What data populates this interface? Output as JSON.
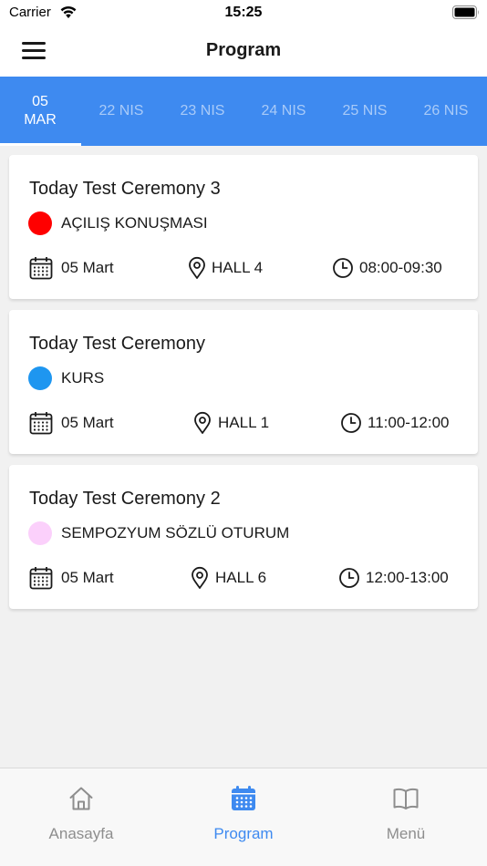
{
  "status_bar": {
    "carrier": "Carrier",
    "time": "15:25",
    "wifi_icon": "wifi-icon",
    "battery_icon": "battery-icon"
  },
  "nav": {
    "title": "Program",
    "menu_icon": "hamburger-menu-icon"
  },
  "date_tabs": [
    {
      "day": "05",
      "month": "MAR",
      "active": true
    },
    {
      "label": "22 NIS",
      "active": false
    },
    {
      "label": "23 NIS",
      "active": false
    },
    {
      "label": "24 NIS",
      "active": false
    },
    {
      "label": "25 NIS",
      "active": false
    },
    {
      "label": "26 NIS",
      "active": false
    }
  ],
  "sessions": [
    {
      "title": "Today Test Ceremony 3",
      "category": "AÇILIŞ KONUŞMASI",
      "category_color": "#ff0000",
      "date": "05 Mart",
      "hall": "HALL 4",
      "time": "08:00-09:30"
    },
    {
      "title": "Today Test Ceremony",
      "category": "KURS",
      "category_color": "#1e96f0",
      "date": "05 Mart",
      "hall": "HALL 1",
      "time": "11:00-12:00"
    },
    {
      "title": "Today Test Ceremony 2",
      "category": "SEMPOZYUM SÖZLÜ OTURUM",
      "category_color": "#fbd0fb",
      "date": "05 Mart",
      "hall": "HALL 6",
      "time": "12:00-13:00"
    }
  ],
  "tab_bar": {
    "items": [
      {
        "label": "Anasayfa",
        "icon": "home-icon",
        "active": false
      },
      {
        "label": "Program",
        "icon": "calendar-icon",
        "active": true
      },
      {
        "label": "Menü",
        "icon": "book-icon",
        "active": false
      }
    ]
  },
  "colors": {
    "accent": "#3e8af0",
    "inactive_tab": "#8e8e8e"
  }
}
